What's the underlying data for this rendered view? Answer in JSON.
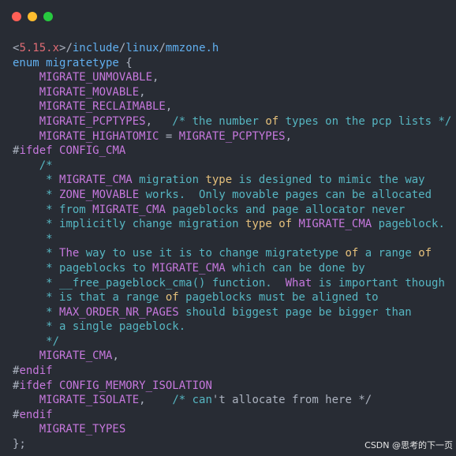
{
  "window": {
    "controls": [
      {
        "name": "close",
        "color": "#ff5f56"
      },
      {
        "name": "minimize",
        "color": "#ffbd2e"
      },
      {
        "name": "maximize",
        "color": "#27c93f"
      }
    ]
  },
  "colors": {
    "background": "#282c34",
    "plain": "#abb2bf",
    "keyword": "#c678dd",
    "identifier": "#c678dd",
    "comment": "#56b6c2",
    "comment_keyword": "#e5c07b",
    "comment_ident": "#c678dd",
    "path": "#61afef",
    "version": "#e06c75",
    "number": "#d19a66"
  },
  "code_lines": [
    [
      [
        "plain",
        "<"
      ],
      [
        "version",
        "5.15.x"
      ],
      [
        "plain",
        ">/"
      ],
      [
        "path",
        "include"
      ],
      [
        "plain",
        "/"
      ],
      [
        "path",
        "linux"
      ],
      [
        "plain",
        "/"
      ],
      [
        "path",
        "mmzone.h"
      ]
    ],
    [
      [
        "path",
        "enum migratetype "
      ],
      [
        "plain",
        "{"
      ]
    ],
    [
      [
        "plain",
        "    "
      ],
      [
        "identifier",
        "MIGRATE_UNMOVABLE"
      ],
      [
        "plain",
        ","
      ]
    ],
    [
      [
        "plain",
        "    "
      ],
      [
        "identifier",
        "MIGRATE_MOVABLE"
      ],
      [
        "plain",
        ","
      ]
    ],
    [
      [
        "plain",
        "    "
      ],
      [
        "identifier",
        "MIGRATE_RECLAIMABLE"
      ],
      [
        "plain",
        ","
      ]
    ],
    [
      [
        "plain",
        "    "
      ],
      [
        "identifier",
        "MIGRATE_PCPTYPES"
      ],
      [
        "plain",
        ",   "
      ],
      [
        "comment",
        "/* the number "
      ],
      [
        "comment_keyword",
        "of"
      ],
      [
        "comment",
        " types on the pcp lists */"
      ]
    ],
    [
      [
        "plain",
        "    "
      ],
      [
        "identifier",
        "MIGRATE_HIGHATOMIC"
      ],
      [
        "plain",
        " = "
      ],
      [
        "identifier",
        "MIGRATE_PCPTYPES"
      ],
      [
        "plain",
        ","
      ]
    ],
    [
      [
        "plain",
        "#"
      ],
      [
        "keyword",
        "ifdef "
      ],
      [
        "identifier",
        "CONFIG_CMA"
      ]
    ],
    [
      [
        "plain",
        "    "
      ],
      [
        "comment",
        "/*"
      ]
    ],
    [
      [
        "plain",
        "     "
      ],
      [
        "comment",
        "* "
      ],
      [
        "comment_ident",
        "MIGRATE_CMA"
      ],
      [
        "comment",
        " migration "
      ],
      [
        "comment_keyword",
        "type"
      ],
      [
        "comment",
        " is designed to mimic the way"
      ]
    ],
    [
      [
        "plain",
        "     "
      ],
      [
        "comment",
        "* "
      ],
      [
        "comment_ident",
        "ZONE_MOVABLE"
      ],
      [
        "comment",
        " works.  Only movable pages can be allocated"
      ]
    ],
    [
      [
        "plain",
        "     "
      ],
      [
        "comment",
        "* from "
      ],
      [
        "comment_ident",
        "MIGRATE_CMA"
      ],
      [
        "comment",
        " pageblocks and page allocator never"
      ]
    ],
    [
      [
        "plain",
        "     "
      ],
      [
        "comment",
        "* implicitly change migration "
      ],
      [
        "comment_keyword",
        "type"
      ],
      [
        "comment",
        " "
      ],
      [
        "comment_keyword",
        "of"
      ],
      [
        "comment",
        " "
      ],
      [
        "comment_ident",
        "MIGRATE_CMA"
      ],
      [
        "comment",
        " pageblock."
      ]
    ],
    [
      [
        "plain",
        "     "
      ],
      [
        "comment",
        "*"
      ]
    ],
    [
      [
        "plain",
        "     "
      ],
      [
        "comment",
        "* "
      ],
      [
        "comment_ident",
        "The"
      ],
      [
        "comment",
        " way to use it is to change migratetype "
      ],
      [
        "comment_keyword",
        "of"
      ],
      [
        "comment",
        " a range "
      ],
      [
        "comment_keyword",
        "of"
      ]
    ],
    [
      [
        "plain",
        "     "
      ],
      [
        "comment",
        "* pageblocks to "
      ],
      [
        "comment_ident",
        "MIGRATE_CMA"
      ],
      [
        "comment",
        " which can be done by"
      ]
    ],
    [
      [
        "plain",
        "     "
      ],
      [
        "comment",
        "* __free_pageblock_cma() function.  "
      ],
      [
        "comment_ident",
        "What"
      ],
      [
        "comment",
        " is important though"
      ]
    ],
    [
      [
        "plain",
        "     "
      ],
      [
        "comment",
        "* is that a range "
      ],
      [
        "comment_keyword",
        "of"
      ],
      [
        "comment",
        " pageblocks must be aligned to"
      ]
    ],
    [
      [
        "plain",
        "     "
      ],
      [
        "comment",
        "* "
      ],
      [
        "comment_ident",
        "MAX_ORDER_NR_PAGES"
      ],
      [
        "comment",
        " should biggest page be bigger than"
      ]
    ],
    [
      [
        "plain",
        "     "
      ],
      [
        "comment",
        "* a single pageblock."
      ]
    ],
    [
      [
        "plain",
        "     "
      ],
      [
        "comment",
        "*/"
      ]
    ],
    [
      [
        "plain",
        "    "
      ],
      [
        "identifier",
        "MIGRATE_CMA"
      ],
      [
        "plain",
        ","
      ]
    ],
    [
      [
        "plain",
        "#"
      ],
      [
        "keyword",
        "endif"
      ]
    ],
    [
      [
        "plain",
        "#"
      ],
      [
        "keyword",
        "ifdef "
      ],
      [
        "identifier",
        "CONFIG_MEMORY_ISOLATION"
      ]
    ],
    [
      [
        "plain",
        "    "
      ],
      [
        "identifier",
        "MIGRATE_ISOLATE"
      ],
      [
        "plain",
        ",    "
      ],
      [
        "comment",
        "/* can"
      ],
      [
        "plain",
        "'t allocate from here */"
      ]
    ],
    [
      [
        "plain",
        "#"
      ],
      [
        "keyword",
        "endif"
      ]
    ],
    [
      [
        "plain",
        "    "
      ],
      [
        "identifier",
        "MIGRATE_TYPES"
      ]
    ],
    [
      [
        "plain",
        "};"
      ]
    ]
  ],
  "watermark": "CSDN @思考的下一页"
}
